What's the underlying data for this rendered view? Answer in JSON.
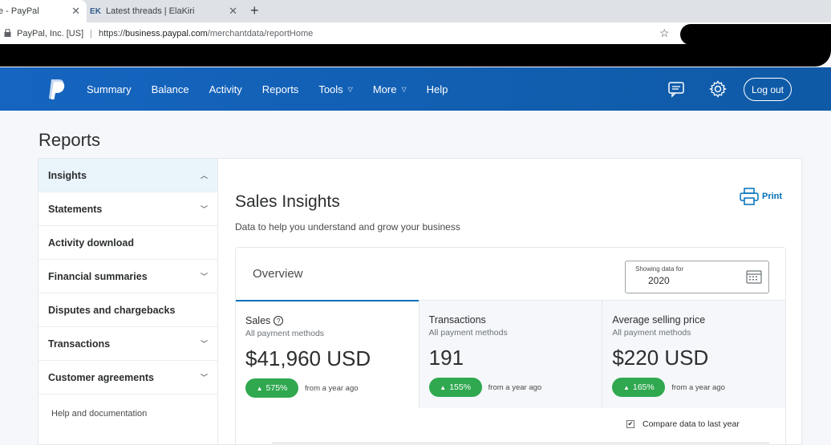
{
  "browser": {
    "tabs": [
      {
        "title": "e - PayPal",
        "active": true
      },
      {
        "title": "Latest threads | ElaKiri",
        "favicon": "EK",
        "active": false
      }
    ],
    "address": {
      "org": "PayPal, Inc. [US]",
      "scheme": "https://",
      "host": "business.paypal.com",
      "path": "/merchantdata/reportHome"
    }
  },
  "nav": {
    "items": [
      {
        "label": "Summary"
      },
      {
        "label": "Balance"
      },
      {
        "label": "Activity"
      },
      {
        "label": "Reports"
      },
      {
        "label": "Tools",
        "dropdown": true
      },
      {
        "label": "More",
        "dropdown": true
      },
      {
        "label": "Help"
      }
    ],
    "logout": "Log out",
    "icons": [
      "message-center-icon",
      "settings-gear-icon"
    ]
  },
  "page": {
    "title": "Reports"
  },
  "sidebar": {
    "items": [
      {
        "label": "Insights",
        "chevron": "up",
        "active": true
      },
      {
        "label": "Statements",
        "chevron": "down"
      },
      {
        "label": "Activity download"
      },
      {
        "label": "Financial summaries",
        "chevron": "down"
      },
      {
        "label": "Disputes and chargebacks"
      },
      {
        "label": "Transactions",
        "chevron": "down"
      },
      {
        "label": "Customer agreements",
        "chevron": "down"
      }
    ],
    "help": "Help and documentation"
  },
  "insights": {
    "title": "Sales Insights",
    "subtitle": "Data to help you understand and grow your business",
    "print": "Print",
    "overview": {
      "title": "Overview",
      "date_label": "Showing data for",
      "date_value": "2020",
      "metrics": [
        {
          "name": "Sales",
          "sub": "All payment methods",
          "value": "$41,960 USD",
          "change": "575%",
          "from": "from a year ago",
          "help": "?"
        },
        {
          "name": "Transactions",
          "sub": "All payment methods",
          "value": "191",
          "change": "155%",
          "from": "from a year ago"
        },
        {
          "name": "Average selling price",
          "sub": "All payment methods",
          "value": "$220 USD",
          "change": "165%",
          "from": "from a year ago"
        }
      ],
      "compare_label": "Compare data to last year",
      "compare_checked": true
    }
  },
  "colors": {
    "nav_blue": "#1565c0",
    "accent": "#0070ba",
    "positive": "#2fa84f"
  }
}
